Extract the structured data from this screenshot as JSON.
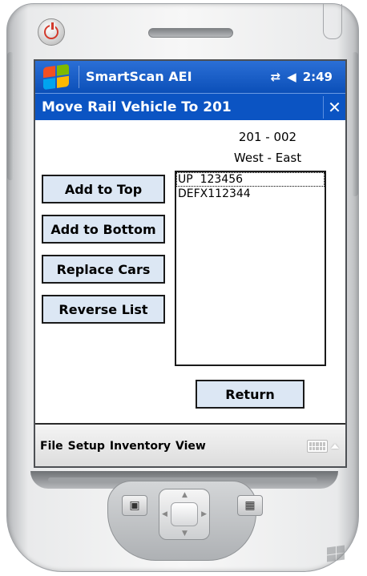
{
  "taskbar": {
    "app_title": "SmartScan AEI",
    "time": "2:49",
    "icons": [
      "start-flag-icon",
      "network-icon",
      "volume-icon"
    ]
  },
  "form": {
    "title": "Move Rail Vehicle To 201",
    "close_label": "✕",
    "location_code": "201 - 002",
    "direction": "West - East"
  },
  "buttons": {
    "add_to_top": "Add to Top",
    "add_to_bottom": "Add to Bottom",
    "replace_cars": "Replace Cars",
    "reverse_list": "Reverse List",
    "return": "Return"
  },
  "car_list": {
    "items": [
      "UP  123456",
      "DEFX112344"
    ],
    "selected_index": 0
  },
  "menu": {
    "items": [
      "File",
      "Setup",
      "Inventory",
      "View"
    ]
  },
  "colors": {
    "taskbar_blue": "#0b4fb8",
    "titlebar_blue": "#0b54c3",
    "button_fill": "#dce7f4"
  }
}
